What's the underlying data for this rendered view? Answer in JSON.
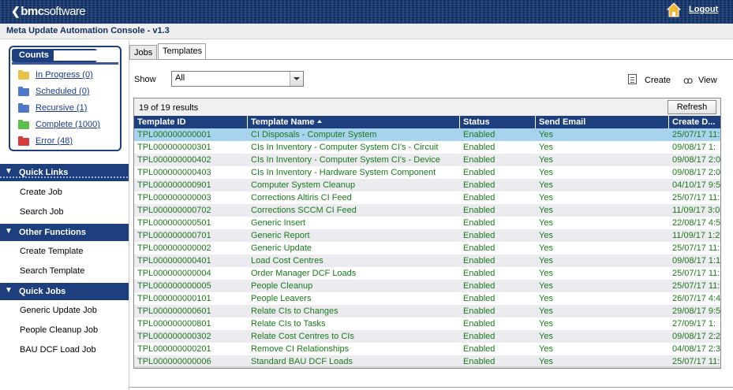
{
  "header": {
    "logo_bold": "bmc",
    "logo_soft": "software",
    "logout_label": "Logout"
  },
  "app": {
    "title": "Meta Update Automation Console - v1.3"
  },
  "colors": {
    "header_bg": "#12305f",
    "panel_blue": "#1d3f7e",
    "row_text_green": "#1a7a1a",
    "selected_row": "#a8d3ef",
    "link_blue": "#1b3a8c"
  },
  "counts": {
    "title": "Counts",
    "items": [
      {
        "label": "In Progress (0)",
        "icon": "folder-yellow-icon",
        "color": "#e8c34a"
      },
      {
        "label": "Scheduled (0)",
        "icon": "folder-blue-icon",
        "color": "#4f78c9"
      },
      {
        "label": "Recursive (1)",
        "icon": "folder-blue-icon",
        "color": "#4f78c9"
      },
      {
        "label": "Complete (1000)",
        "icon": "folder-green-icon",
        "color": "#5cbf4a"
      },
      {
        "label": "Error (48)",
        "icon": "folder-red-icon",
        "color": "#d83b3b"
      }
    ]
  },
  "sidebar": {
    "quick_links": {
      "title": "Quick Links",
      "items": [
        "Create Job",
        "Search Job"
      ]
    },
    "other_functions": {
      "title": "Other Functions",
      "items": [
        "Create Template",
        "Search Template"
      ]
    },
    "quick_jobs": {
      "title": "Quick Jobs",
      "items": [
        "Generic Update Job",
        "People Cleanup Job",
        "BAU DCF Load Job"
      ]
    }
  },
  "tabs": [
    {
      "label": "Jobs",
      "active": false
    },
    {
      "label": "Templates",
      "active": true
    }
  ],
  "toolbar": {
    "show_label": "Show",
    "show_value": "All",
    "create_label": "Create",
    "view_label": "View"
  },
  "grid": {
    "results_text": "19 of 19 results",
    "refresh_label": "Refresh",
    "columns": [
      "Template ID",
      "Template Name",
      "Status",
      "Send Email",
      "Create D..."
    ],
    "sorted_column": "Template Name",
    "rows": [
      [
        "TPL000000000001",
        "CI Disposals - Computer System",
        "Enabled",
        "Yes",
        "25/07/17 11:"
      ],
      [
        "TPL000000000301",
        "CIs In Inventory - Computer System CI's - Circuit",
        "Enabled",
        "Yes",
        "09/08/17 1:"
      ],
      [
        "TPL000000000402",
        "CIs In Inventory - Computer System CI's - Device",
        "Enabled",
        "Yes",
        "09/08/17 2:0"
      ],
      [
        "TPL000000000403",
        "CIs In Inventory - Hardware System Component",
        "Enabled",
        "Yes",
        "09/08/17 2:0"
      ],
      [
        "TPL000000000901",
        "Computer System Cleanup",
        "Enabled",
        "Yes",
        "04/10/17 9:5"
      ],
      [
        "TPL000000000003",
        "Corrections Altiris CI Feed",
        "Enabled",
        "Yes",
        "25/07/17 11:"
      ],
      [
        "TPL000000000702",
        "Corrections SCCM CI Feed",
        "Enabled",
        "Yes",
        "11/09/17 3:0"
      ],
      [
        "TPL000000000501",
        "Generic Insert",
        "Enabled",
        "Yes",
        "22/08/17 4:5"
      ],
      [
        "TPL000000000701",
        "Generic Report",
        "Enabled",
        "Yes",
        "11/09/17 1:2"
      ],
      [
        "TPL000000000002",
        "Generic Update",
        "Enabled",
        "Yes",
        "25/07/17 11:"
      ],
      [
        "TPL000000000401",
        "Load Cost Centres",
        "Enabled",
        "Yes",
        "09/08/17 1:1"
      ],
      [
        "TPL000000000004",
        "Order Manager DCF Loads",
        "Enabled",
        "Yes",
        "25/07/17 11:"
      ],
      [
        "TPL000000000005",
        "People Cleanup",
        "Enabled",
        "Yes",
        "25/07/17 11:"
      ],
      [
        "TPL000000000101",
        "People Leavers",
        "Enabled",
        "Yes",
        "26/07/17 4:4"
      ],
      [
        "TPL000000000601",
        "Relate CIs to Changes",
        "Enabled",
        "Yes",
        "29/08/17 9:5"
      ],
      [
        "TPL000000000801",
        "Relate CIs to Tasks",
        "Enabled",
        "Yes",
        "27/09/17 1:"
      ],
      [
        "TPL000000000302",
        "Relate Cost Centres to CIs",
        "Enabled",
        "Yes",
        "09/08/17 2:2"
      ],
      [
        "TPL000000000201",
        "Remove CI Relationships",
        "Enabled",
        "Yes",
        "04/08/17 2:3"
      ],
      [
        "TPL000000000006",
        "Standard BAU DCF Loads",
        "Enabled",
        "Yes",
        "25/07/17 11:"
      ]
    ]
  }
}
